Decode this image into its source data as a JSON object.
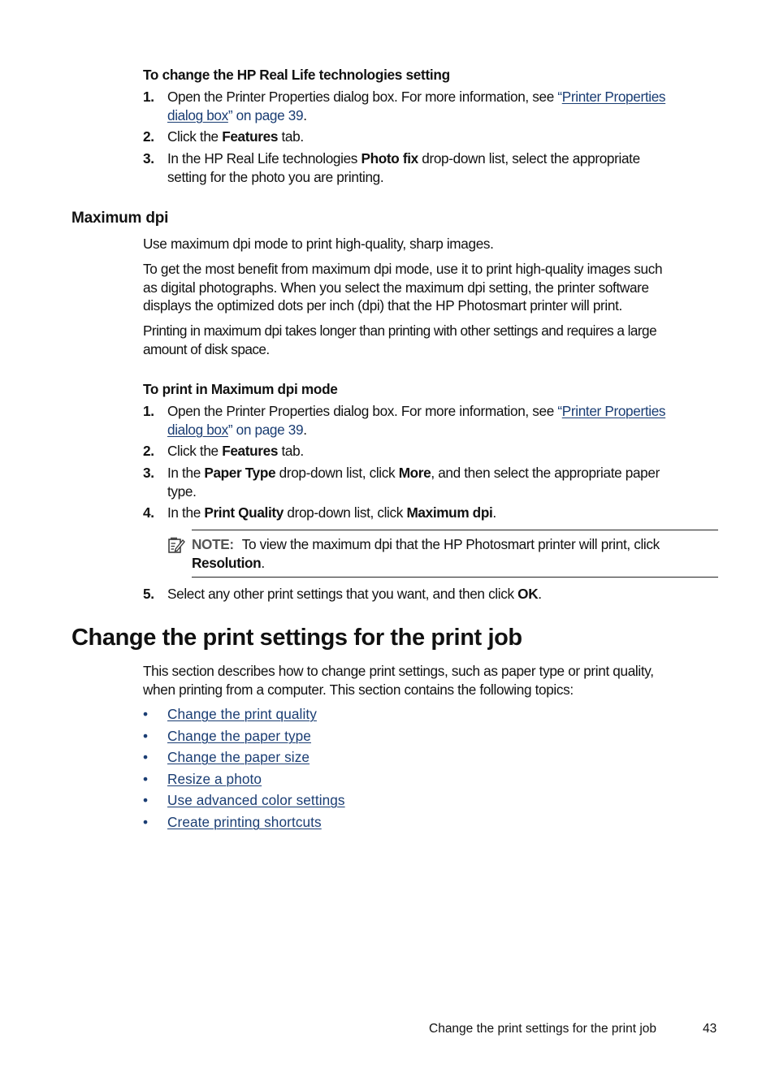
{
  "section1": {
    "procedure_title": "To change the HP Real Life technologies setting",
    "steps": [
      {
        "num": "1.",
        "pre": "Open the Printer Properties dialog box. For more information, see ",
        "link_open_quote": "“",
        "link_line1": "Printer Properties",
        "link_line2": "dialog box",
        "link_close": "” on page 39",
        "post": "."
      },
      {
        "num": "2.",
        "pre": "Click the ",
        "bold": "Features",
        "post": " tab."
      },
      {
        "num": "3.",
        "pre": "In the HP Real Life technologies ",
        "bold": "Photo fix",
        "post": " drop-down list, select the appropriate",
        "line2": "setting for the photo you are printing."
      }
    ]
  },
  "max_dpi": {
    "heading": "Maximum dpi",
    "para1": "Use maximum dpi mode to print high-quality, sharp images.",
    "para2_lines": [
      "To get the most benefit from maximum dpi mode, use it to print high-quality images such",
      "as digital photographs. When you select the maximum dpi setting, the printer software",
      "displays the optimized dots per inch (dpi) that the HP Photosmart printer will print."
    ],
    "para3_lines": [
      "Printing in maximum dpi takes longer than printing with other settings and requires a large",
      "amount of disk space."
    ],
    "procedure_title": "To print in Maximum dpi mode",
    "steps": [
      {
        "num": "1.",
        "pre": "Open the Printer Properties dialog box. For more information, see ",
        "link_open_quote": "“",
        "link_line1": "Printer Properties",
        "link_line2": "dialog box",
        "link_close": "” on page 39",
        "post": "."
      },
      {
        "num": "2.",
        "pre": "Click the ",
        "bold": "Features",
        "post": " tab."
      },
      {
        "num": "3.",
        "pre": "In the ",
        "bold": "Paper Type",
        "mid": " drop-down list, click ",
        "bold2": "More",
        "post": ", and then select the appropriate paper",
        "line2": "type."
      },
      {
        "num": "4.",
        "pre": "In the ",
        "bold": "Print Quality",
        "mid": " drop-down list, click ",
        "bold2": "Maximum dpi",
        "post": "."
      },
      {
        "num": "5.",
        "pre": "Select any other print settings that you want, and then click ",
        "bold": "OK",
        "post": "."
      }
    ],
    "note": {
      "icon": "note-pencil-icon",
      "label": "NOTE:",
      "text": "To view the maximum dpi that the HP Photosmart printer will print, click",
      "bold_line2": "Resolution",
      "post": "."
    }
  },
  "change_settings": {
    "heading": "Change the print settings for the print job",
    "intro_lines": [
      "This section describes how to change print settings, such as paper type or print quality,",
      "when printing from a computer. This section contains the following topics:"
    ],
    "bullet_glyph": "•",
    "topics": [
      "Change the print quality",
      "Change the paper type",
      "Change the paper size",
      "Resize a photo",
      "Use advanced color settings",
      "Create printing shortcuts"
    ]
  },
  "footer": {
    "section_title": "Change the print settings for the print job",
    "page_number": "43"
  },
  "colors": {
    "link": "#1a3d73",
    "text": "#111111",
    "note_label": "#555555"
  }
}
